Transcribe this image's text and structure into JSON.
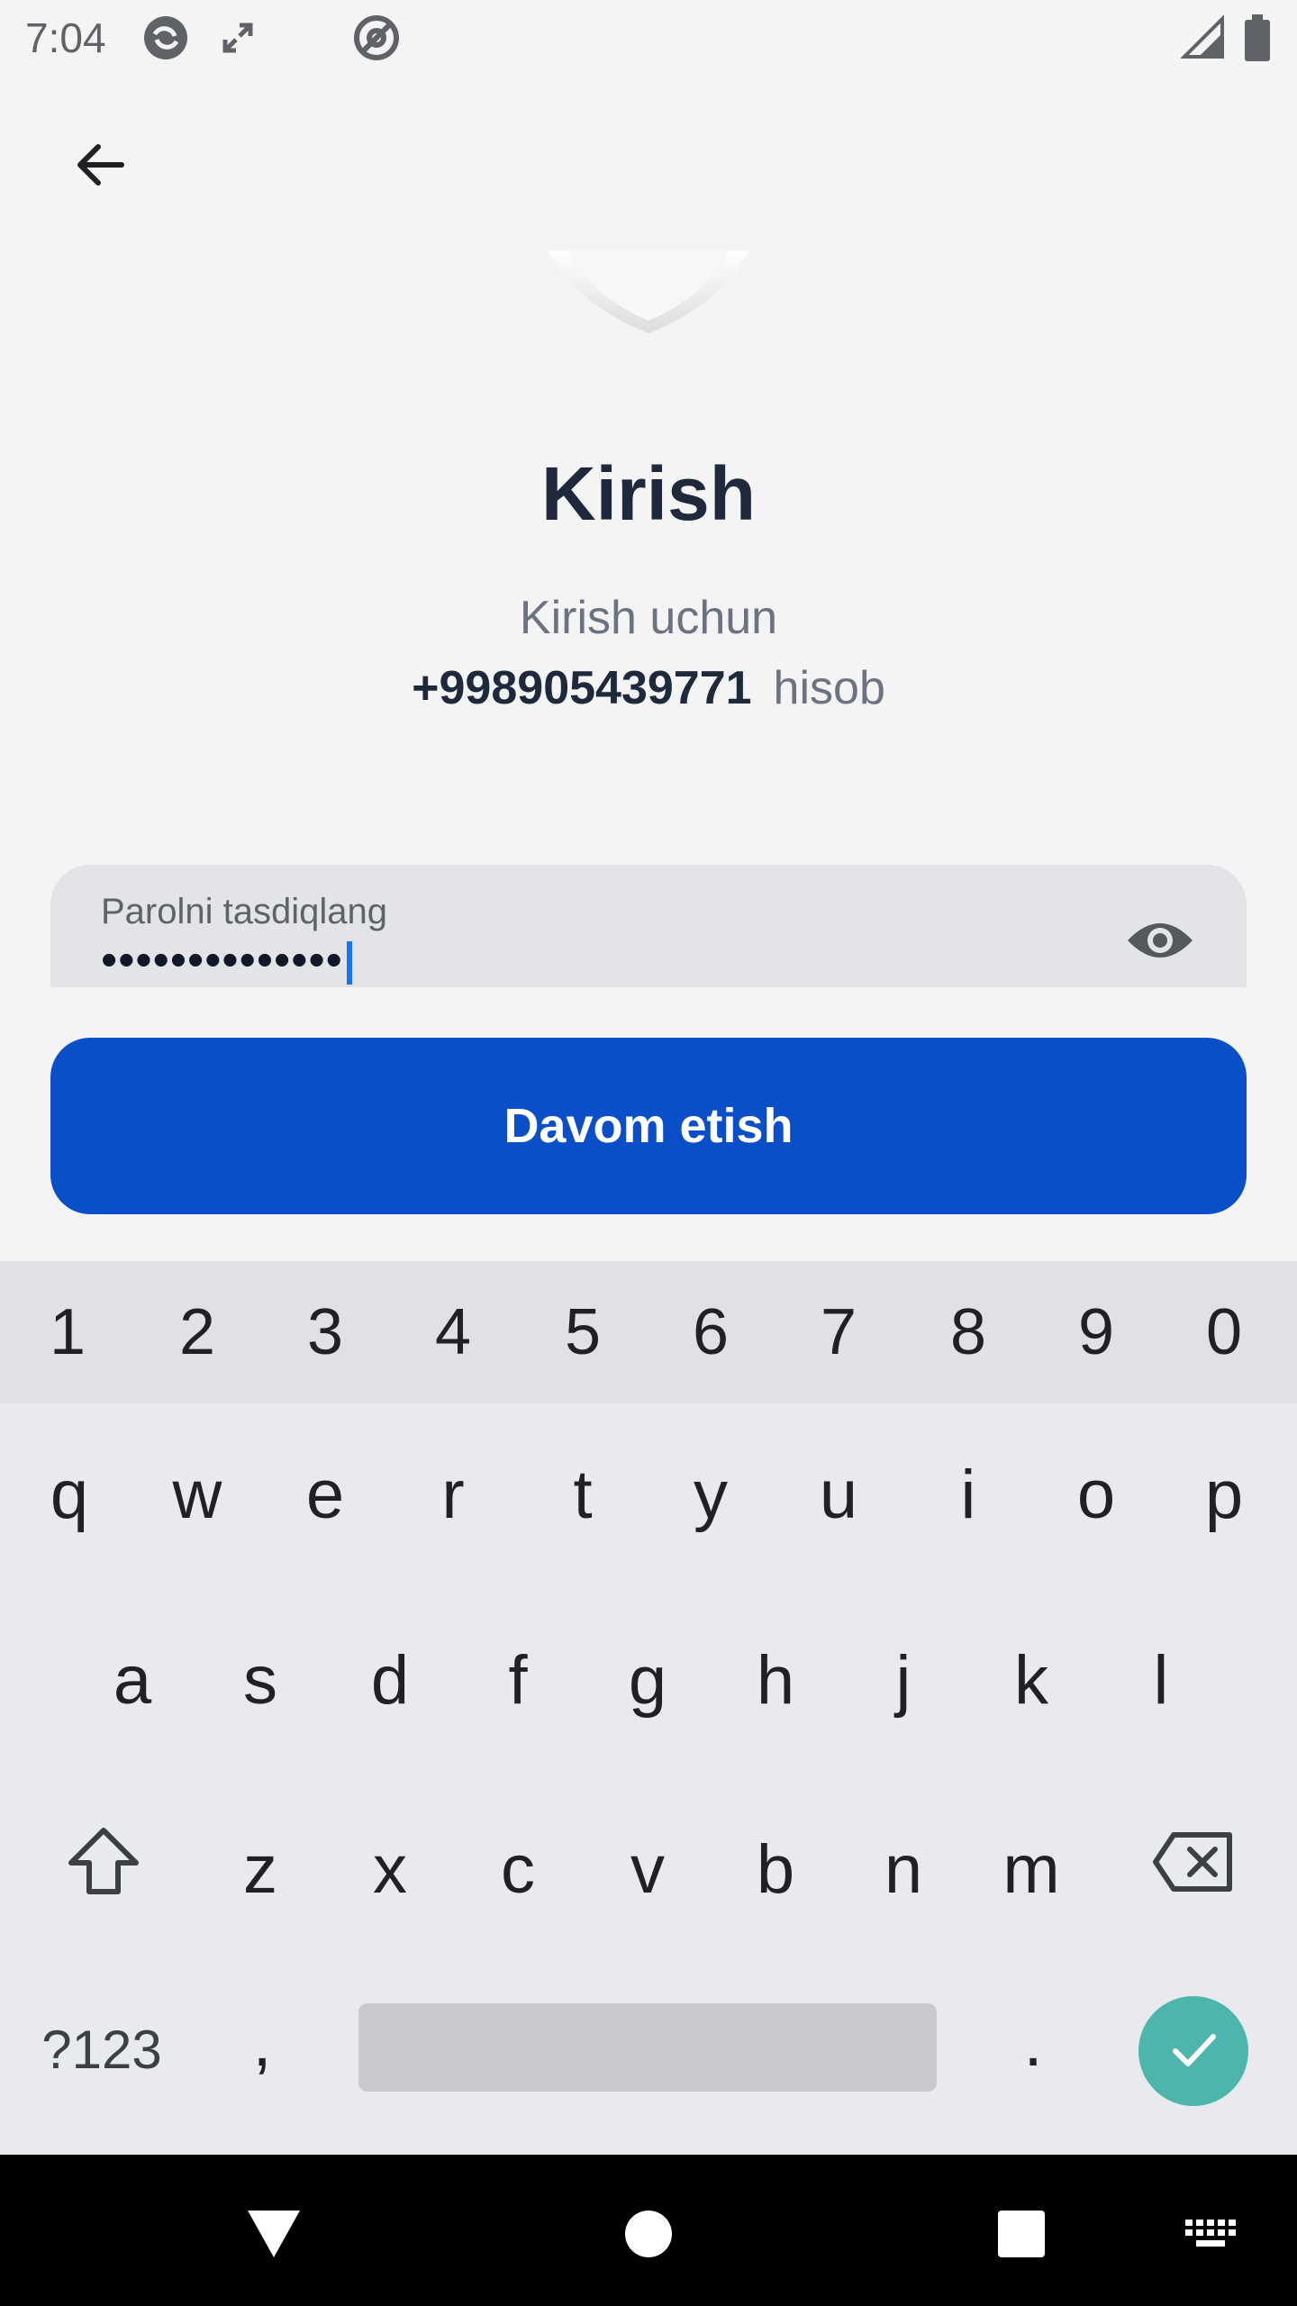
{
  "status_bar": {
    "time": "7:04",
    "icons": [
      "sync-icon",
      "expand-icon",
      "at-icon",
      "signal-icon",
      "battery-icon"
    ]
  },
  "app_bar": {
    "back_icon": "arrow-left-icon"
  },
  "header": {
    "title": "Kirish",
    "subtitle": "Kirish uchun",
    "phone": "+998905439771",
    "account_word": "hisob"
  },
  "password_field": {
    "label": "Parolni tasdiqlang",
    "value": "••••••••••••••",
    "toggle_icon": "eye-icon"
  },
  "continue_button": {
    "label": "Davom etish",
    "color": "#0b4fc8"
  },
  "keyboard": {
    "number_row": [
      "1",
      "2",
      "3",
      "4",
      "5",
      "6",
      "7",
      "8",
      "9",
      "0"
    ],
    "row1": [
      "q",
      "w",
      "e",
      "r",
      "t",
      "y",
      "u",
      "i",
      "o",
      "p"
    ],
    "row2": [
      "a",
      "s",
      "d",
      "f",
      "g",
      "h",
      "j",
      "k",
      "l"
    ],
    "row3": [
      "z",
      "x",
      "c",
      "v",
      "b",
      "n",
      "m"
    ],
    "symbols_key": "?123",
    "comma_key": ",",
    "period_key": ".",
    "enter_color": "#4db6ac"
  },
  "nav_bar": {
    "icons": [
      "back-triangle-icon",
      "home-circle-icon",
      "recents-square-icon",
      "keyboard-icon"
    ]
  }
}
